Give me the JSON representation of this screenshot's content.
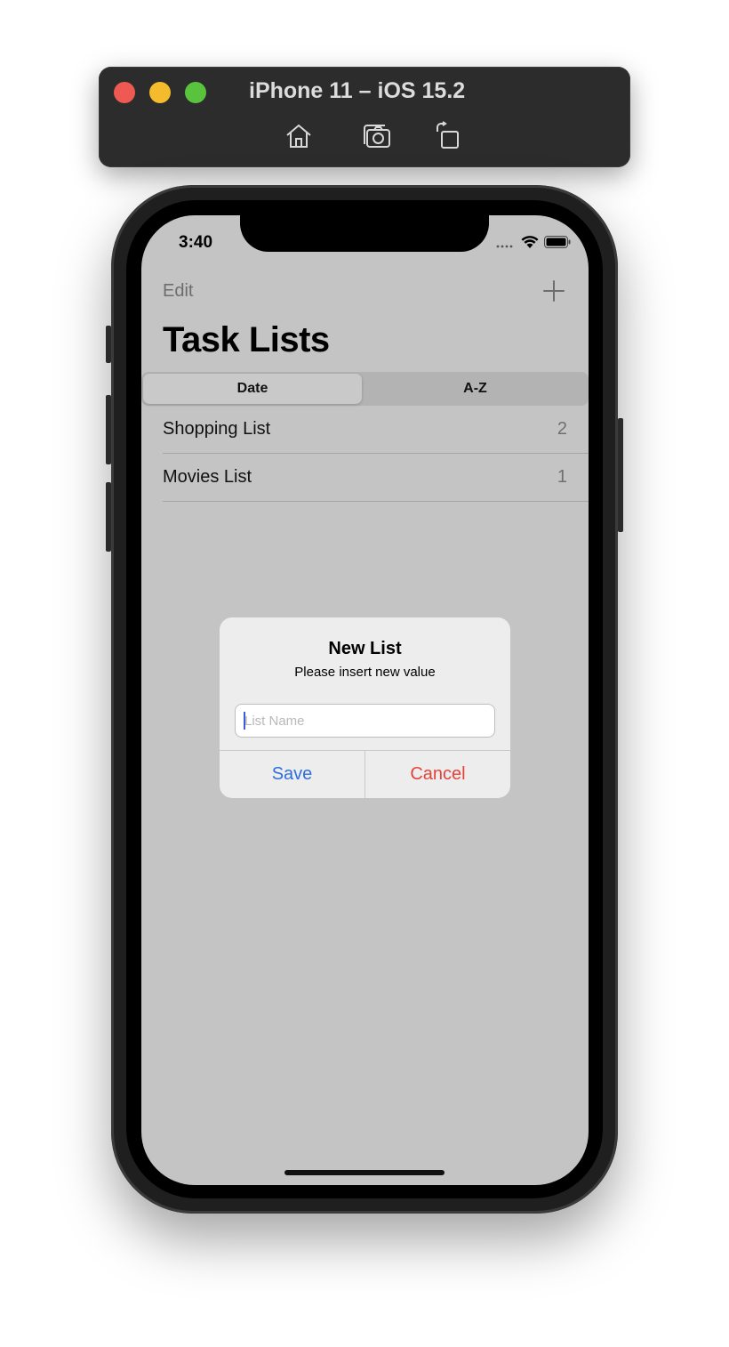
{
  "simulator": {
    "title": "iPhone 11 – iOS 15.2",
    "icons": [
      "home-icon",
      "screenshot-icon",
      "rotate-icon"
    ]
  },
  "status_bar": {
    "time": "3:40",
    "icons": [
      "cellular-icon",
      "wifi-icon",
      "battery-icon"
    ]
  },
  "nav": {
    "edit_label": "Edit",
    "add_icon": "plus-icon",
    "title": "Task Lists"
  },
  "segmented": {
    "options": [
      "Date",
      "A-Z"
    ],
    "selected": "Date"
  },
  "lists": [
    {
      "name": "Shopping List",
      "count": "2"
    },
    {
      "name": "Movies List",
      "count": "1"
    }
  ],
  "alert": {
    "title": "New List",
    "message": "Please insert new value",
    "input_placeholder": "List Name",
    "input_value": "",
    "save_label": "Save",
    "cancel_label": "Cancel"
  },
  "colors": {
    "screen_dim": "#c4c4c4",
    "save_blue": "#2f6fdb",
    "cancel_red": "#e5423a"
  }
}
